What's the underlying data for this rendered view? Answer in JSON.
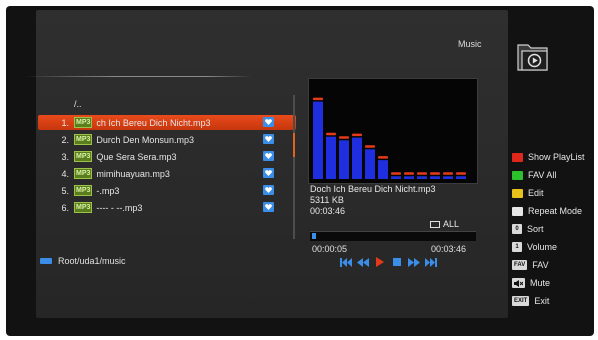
{
  "panel": {
    "title": "Music",
    "folder_icon": "music-folder-icon"
  },
  "browser": {
    "up_dir": "/..",
    "path": "Root/uda1/music",
    "badge": "MP3",
    "files": [
      {
        "num": "1.",
        "name": "ch Ich Bereu  Dich Nicht.mp3",
        "selected": true
      },
      {
        "num": "2.",
        "name": "Durch Den Monsun.mp3",
        "selected": false
      },
      {
        "num": "3.",
        "name": "Que Sera Sera.mp3",
        "selected": false
      },
      {
        "num": "4.",
        "name": "mimihuayuan.mp3",
        "selected": false
      },
      {
        "num": "5.",
        "name": "-.mp3",
        "selected": false
      },
      {
        "num": "6.",
        "name": "---- - --.mp3",
        "selected": false
      }
    ]
  },
  "spectrum": {
    "bars": [
      0.86,
      0.47,
      0.43,
      0.46,
      0.33,
      0.21,
      0.03,
      0.03,
      0.03,
      0.03,
      0.03,
      0.03
    ],
    "bar_color": "#1f2fe0",
    "peak_color": "#e53a1a"
  },
  "now_playing": {
    "title": "Doch Ich Bereu  Dich Nicht.mp3",
    "size": "5311 KB",
    "duration": "00:03:46",
    "repeat_mode": "ALL",
    "elapsed": "00:00:05",
    "total": "00:03:46",
    "progress": 0.022
  },
  "controls": [
    "prev-track-icon",
    "rewind-icon",
    "play-icon",
    "stop-icon",
    "fast-forward-icon",
    "next-track-icon"
  ],
  "legend": {
    "show_playlist": "Show PlayList",
    "fav_all": "FAV All",
    "edit": "Edit",
    "repeat_mode": "Repeat Mode",
    "sort_key": "0",
    "sort": "Sort",
    "volume_key": "1",
    "volume": "Volume",
    "fav_key": "FAV",
    "fav": "FAV",
    "mute_key": "🔇",
    "mute": "Mute",
    "exit_key": "EXIT",
    "exit": "Exit"
  },
  "colors": {
    "red": "#e0271b",
    "green": "#2cc12c",
    "yellow": "#e8c21a",
    "white": "#e6e6e6",
    "accent": "#3b8ee8",
    "selection": "#d8441a"
  }
}
